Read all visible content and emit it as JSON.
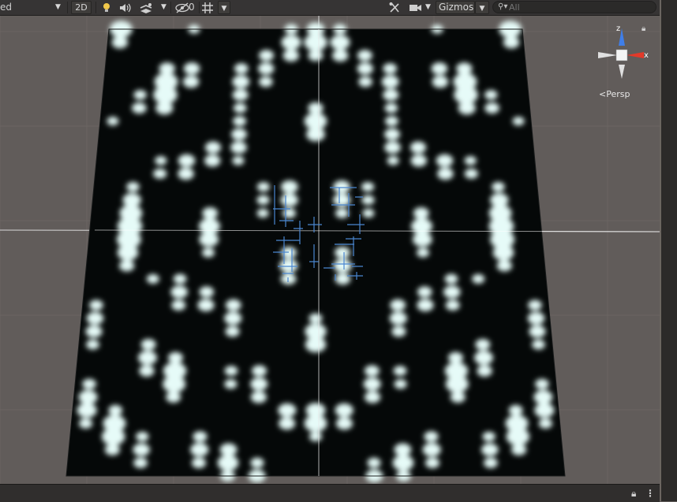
{
  "toolbar": {
    "shading_mode_partial": "ed",
    "mode_2d_label": "2D",
    "effects_hidden_count": "0",
    "gizmos_label": "Gizmos",
    "search_placeholder": "All"
  },
  "scene": {
    "projection_label": "Persp",
    "axis_x_label": "x",
    "axis_z_label": "z"
  },
  "icons": [
    "lighting-icon",
    "audio-icon",
    "effects-icon",
    "visibility-icon",
    "grid-icon",
    "tools-icon",
    "camera-icon",
    "search-icon",
    "lock-icon",
    "menu-dots-icon"
  ],
  "colors": {
    "toolbar": "#363434",
    "scene_background": "#615c5a",
    "wave_dark": "#050808",
    "wave_light": "#e6fbf8",
    "axis_x": "#e23a2a",
    "axis_z": "#3f7ee8",
    "selection_outline": "#4a86d0"
  }
}
